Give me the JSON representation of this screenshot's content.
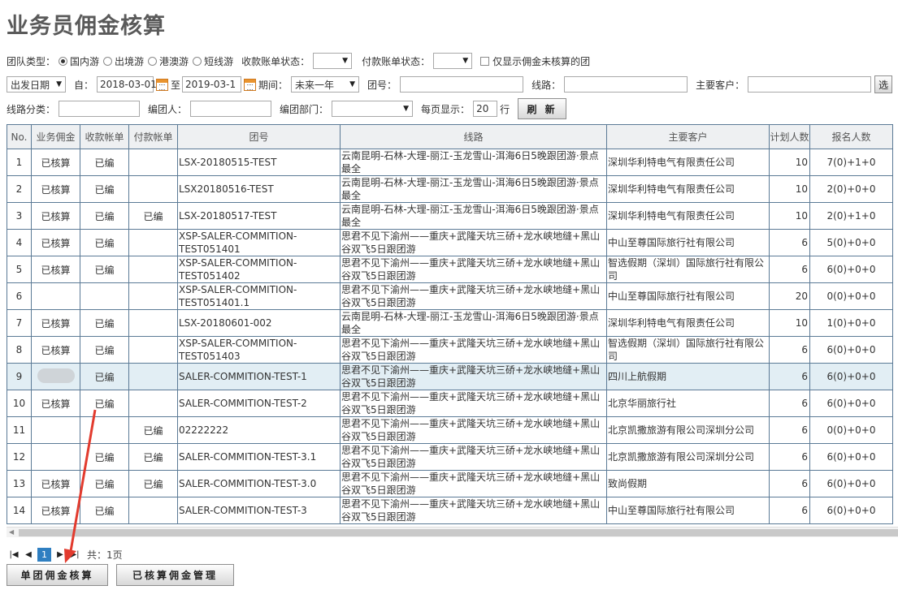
{
  "page": {
    "title": "业务员佣金核算"
  },
  "filters": {
    "team_type_label": "团队类型：",
    "team_types": [
      "国内游",
      "出境游",
      "港澳游",
      "短线游"
    ],
    "team_type_selected": "国内游",
    "receivable_status_label": "收款账单状态：",
    "receivable_status_value": "",
    "payable_status_label": "付款账单状态：",
    "payable_status_value": "",
    "only_unaccounted_label": "仅显示佣金未核算的团",
    "date_type": "出发日期",
    "from_label": "自：",
    "from_date": "2018-03-01",
    "to_label": "至",
    "to_date": "2019-03-1",
    "period_label": "期间：",
    "period_value": "未来一年",
    "team_no_label": "团号：",
    "route_label": "线路：",
    "main_customer_label": "主要客户：",
    "select_button": "选",
    "route_category_label": "线路分类：",
    "creator_label": "编团人：",
    "dept_label": "编团部门：",
    "page_size_label": "每页显示：",
    "page_size_value": "20",
    "page_size_unit": "行",
    "refresh_button": "刷 新"
  },
  "table": {
    "headers": [
      "No.",
      "业务佣金",
      "收款帐单",
      "付款帐单",
      "团号",
      "线路",
      "主要客户",
      "计划人数",
      "报名人数"
    ],
    "rows": [
      {
        "no": "1",
        "commission": "已核算",
        "receivable": "已编",
        "payable": "",
        "team_no": "LSX-20180515-TEST",
        "route": "云南昆明-石林-大理-丽江-玉龙雪山-洱海6日5晚跟团游·景点最全",
        "customer": "深圳华利特电气有限责任公司",
        "planned": "10",
        "signed": "7(0)+1+0"
      },
      {
        "no": "2",
        "commission": "已核算",
        "receivable": "已编",
        "payable": "",
        "team_no": "LSX20180516-TEST",
        "route": "云南昆明-石林-大理-丽江-玉龙雪山-洱海6日5晚跟团游·景点最全",
        "customer": "深圳华利特电气有限责任公司",
        "planned": "10",
        "signed": "2(0)+0+0"
      },
      {
        "no": "3",
        "commission": "已核算",
        "receivable": "已编",
        "payable": "已编",
        "team_no": "LSX-20180517-TEST",
        "route": "云南昆明-石林-大理-丽江-玉龙雪山-洱海6日5晚跟团游·景点最全",
        "customer": "深圳华利特电气有限责任公司",
        "planned": "10",
        "signed": "2(0)+1+0"
      },
      {
        "no": "4",
        "commission": "已核算",
        "receivable": "已编",
        "payable": "",
        "team_no": "XSP-SALER-COMMITION-TEST051401",
        "route": "思君不见下渝州——重庆+武隆天坑三硚+龙水峡地缝+黑山谷双飞5日跟团游",
        "customer": "中山至尊国际旅行社有限公司",
        "planned": "6",
        "signed": "5(0)+0+0"
      },
      {
        "no": "5",
        "commission": "已核算",
        "receivable": "已编",
        "payable": "",
        "team_no": "XSP-SALER-COMMITION-TEST051402",
        "route": "思君不见下渝州——重庆+武隆天坑三硚+龙水峡地缝+黑山谷双飞5日跟团游",
        "customer": "智选假期（深圳）国际旅行社有限公司",
        "planned": "6",
        "signed": "6(0)+0+0"
      },
      {
        "no": "6",
        "commission": "",
        "receivable": "",
        "payable": "",
        "team_no": "XSP-SALER-COMMITION-TEST051401.1",
        "route": "思君不见下渝州——重庆+武隆天坑三硚+龙水峡地缝+黑山谷双飞5日跟团游",
        "customer": "中山至尊国际旅行社有限公司",
        "planned": "20",
        "signed": "0(0)+0+0"
      },
      {
        "no": "7",
        "commission": "已核算",
        "receivable": "已编",
        "payable": "",
        "team_no": "LSX-20180601-002",
        "route": "云南昆明-石林-大理-丽江-玉龙雪山-洱海6日5晚跟团游·景点最全",
        "customer": "深圳华利特电气有限责任公司",
        "planned": "10",
        "signed": "1(0)+0+0"
      },
      {
        "no": "8",
        "commission": "已核算",
        "receivable": "已编",
        "payable": "",
        "team_no": "XSP-SALER-COMMITION-TEST051403",
        "route": "思君不见下渝州——重庆+武隆天坑三硚+龙水峡地缝+黑山谷双飞5日跟团游",
        "customer": "智选假期（深圳）国际旅行社有限公司",
        "planned": "6",
        "signed": "6(0)+0+0"
      },
      {
        "no": "9",
        "commission": "",
        "receivable": "已编",
        "payable": "",
        "team_no": "SALER-COMMITION-TEST-1",
        "route": "思君不见下渝州——重庆+武隆天坑三硚+龙水峡地缝+黑山谷双飞5日跟团游",
        "customer": "四川上航假期",
        "planned": "6",
        "signed": "6(0)+0+0",
        "highlight": true,
        "blurred": true
      },
      {
        "no": "10",
        "commission": "已核算",
        "receivable": "已编",
        "payable": "",
        "team_no": "SALER-COMMITION-TEST-2",
        "route": "思君不见下渝州——重庆+武隆天坑三硚+龙水峡地缝+黑山谷双飞5日跟团游",
        "customer": "北京华丽旅行社",
        "planned": "6",
        "signed": "6(0)+0+0"
      },
      {
        "no": "11",
        "commission": "",
        "receivable": "",
        "payable": "已编",
        "team_no": "02222222",
        "route": "思君不见下渝州——重庆+武隆天坑三硚+龙水峡地缝+黑山谷双飞5日跟团游",
        "customer": "北京凯撒旅游有限公司深圳分公司",
        "planned": "6",
        "signed": "0(0)+0+0"
      },
      {
        "no": "12",
        "commission": "",
        "receivable": "已编",
        "payable": "已编",
        "team_no": "SALER-COMMITION-TEST-3.1",
        "route": "思君不见下渝州——重庆+武隆天坑三硚+龙水峡地缝+黑山谷双飞5日跟团游",
        "customer": "北京凯撒旅游有限公司深圳分公司",
        "planned": "6",
        "signed": "6(0)+0+0"
      },
      {
        "no": "13",
        "commission": "已核算",
        "receivable": "已编",
        "payable": "已编",
        "team_no": "SALER-COMMITION-TEST-3.0",
        "route": "思君不见下渝州——重庆+武隆天坑三硚+龙水峡地缝+黑山谷双飞5日跟团游",
        "customer": "致尚假期",
        "planned": "6",
        "signed": "6(0)+0+0"
      },
      {
        "no": "14",
        "commission": "已核算",
        "receivable": "已编",
        "payable": "",
        "team_no": "SALER-COMMITION-TEST-3",
        "route": "思君不见下渝州——重庆+武隆天坑三硚+龙水峡地缝+黑山谷双飞5日跟团游",
        "customer": "中山至尊国际旅行社有限公司",
        "planned": "6",
        "signed": "6(0)+0+0"
      }
    ]
  },
  "pagination": {
    "current_page": "1",
    "total_text": "共：1页"
  },
  "actions": {
    "single_commission": "单团佣金核算",
    "accounted_management": "已核算佣金管理"
  },
  "colors": {
    "accent": "#2f7fc1",
    "annotation": "#e23b2e",
    "row_highlight": "#e2eef4",
    "grid": "#5b7a96"
  }
}
